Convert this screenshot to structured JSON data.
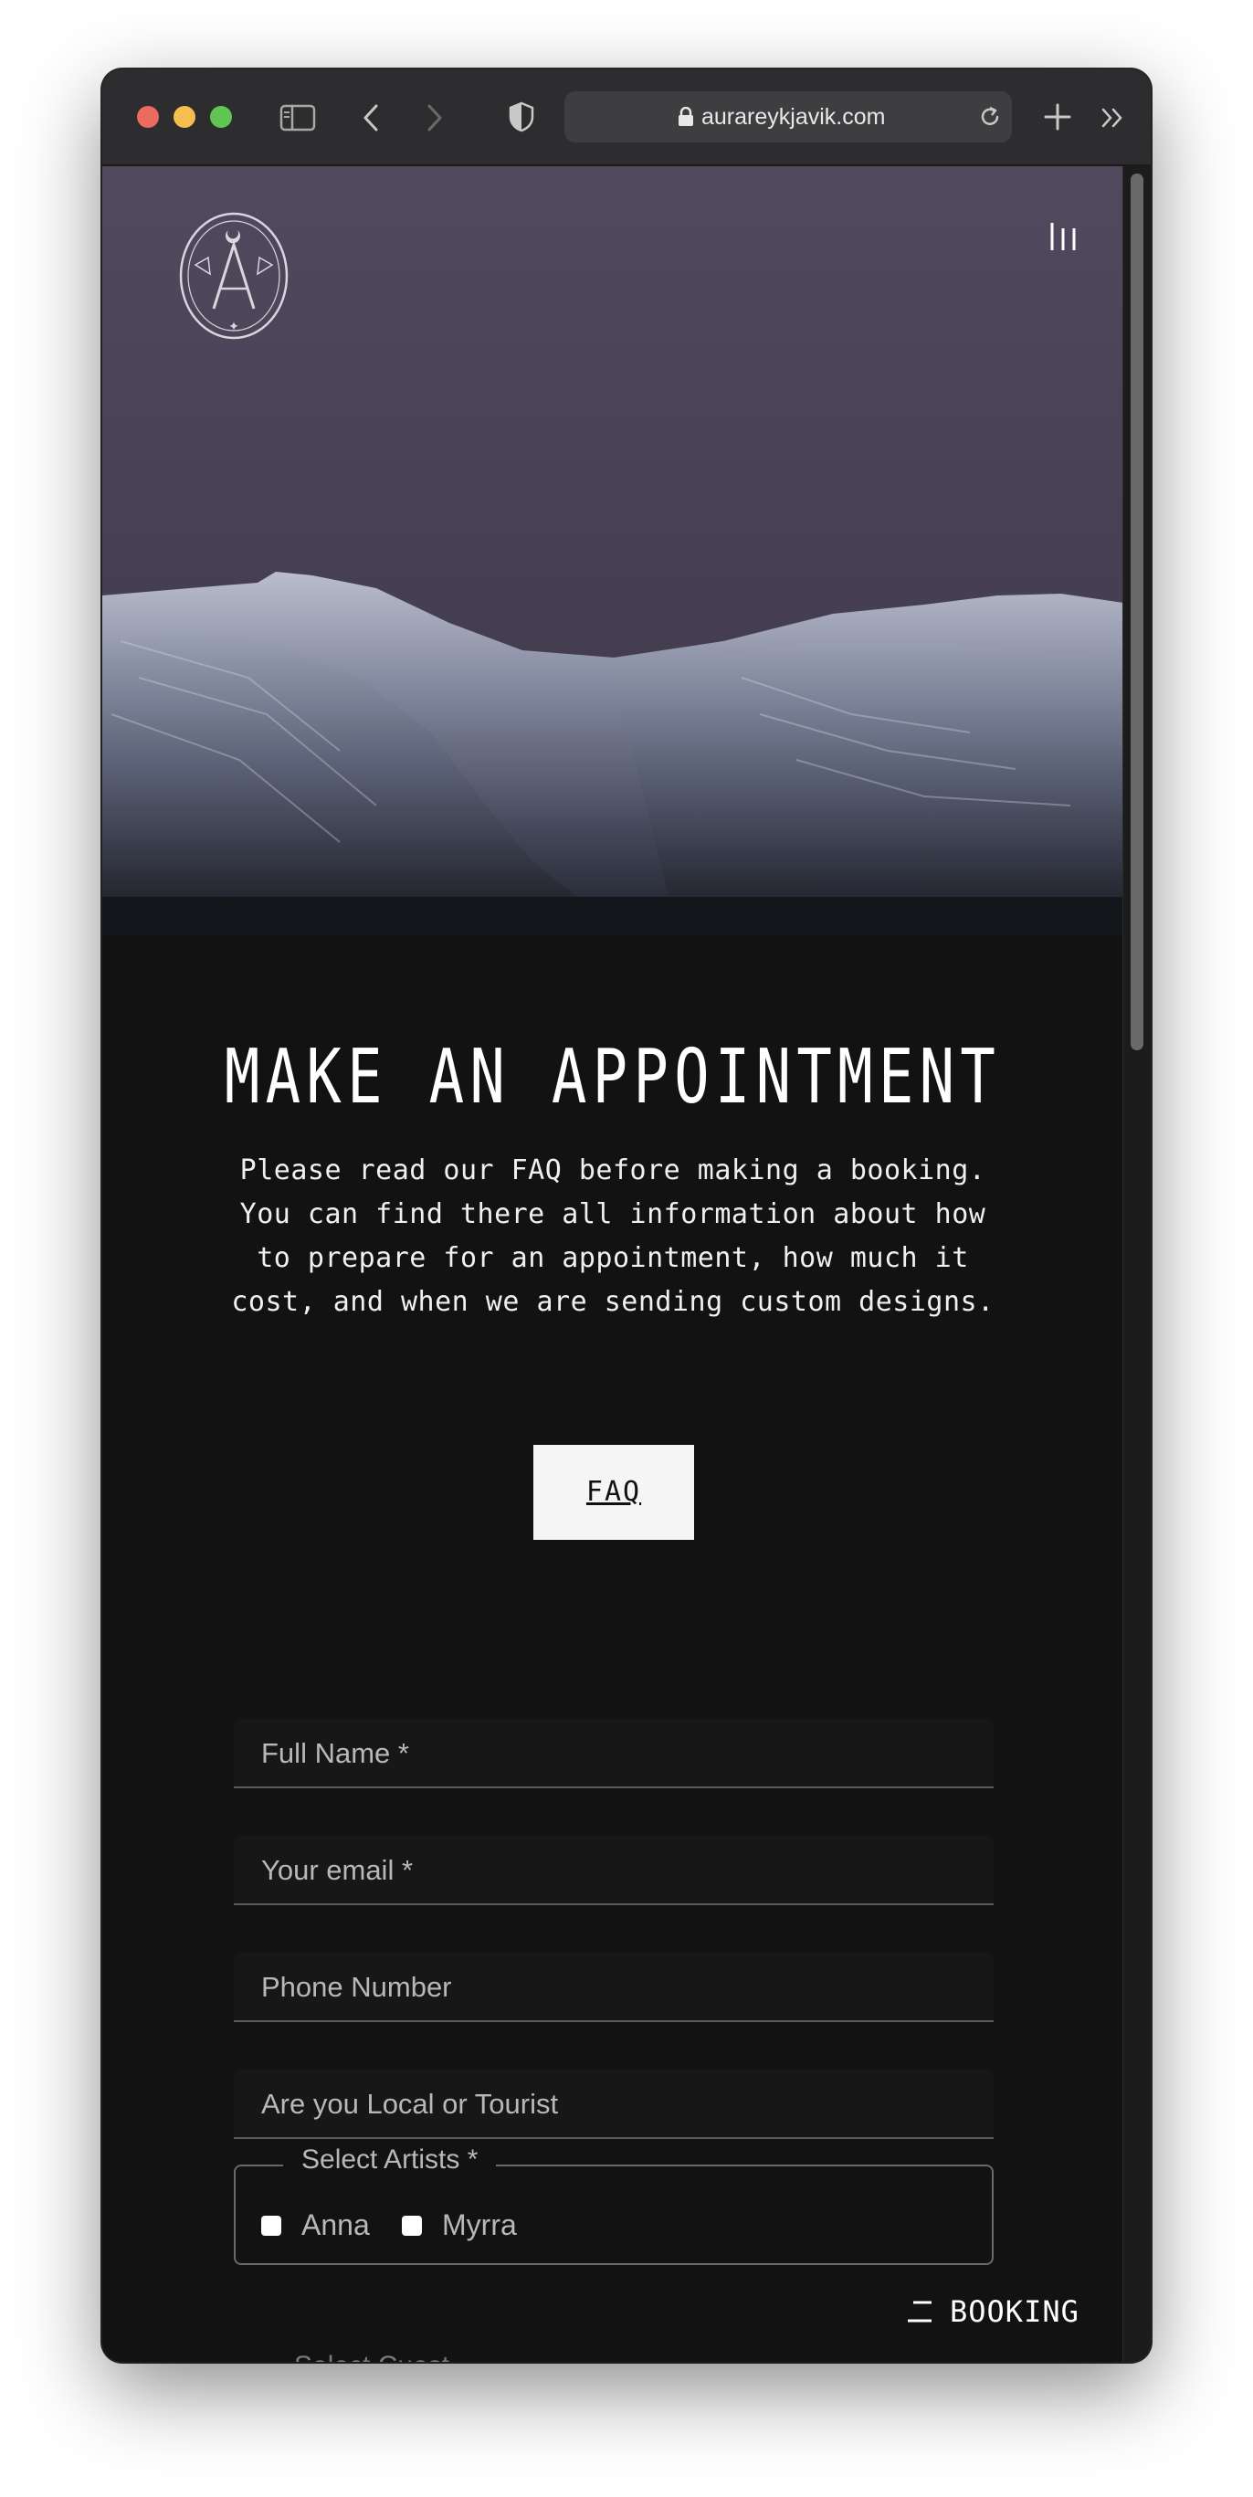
{
  "browser": {
    "url": "aurareykjavik.com",
    "traffic_light_colors": [
      "#ec6a5e",
      "#f4bf4f",
      "#61c554"
    ]
  },
  "page": {
    "title": "MAKE AN APPOINTMENT",
    "intro": "Please read our FAQ before making a booking. You can find there all information about how to prepare for an appointment, how much it cost, and when we are sending custom designs.",
    "faq_button": "FAQ",
    "form": {
      "full_name_placeholder": "Full Name *",
      "email_placeholder": "Your email *",
      "phone_placeholder": "Phone Number",
      "local_placeholder": "Are you Local or Tourist",
      "artists_legend": "Select Artists *",
      "artists": [
        "Anna",
        "Myrra"
      ],
      "next_legend_partial": "Select Cuest..."
    },
    "booking_button": "BOOKING"
  }
}
